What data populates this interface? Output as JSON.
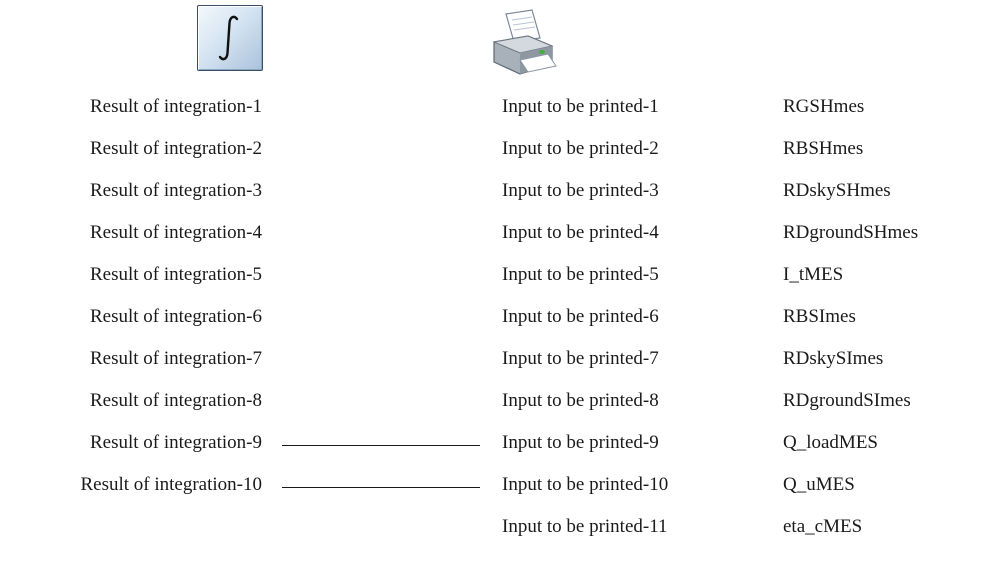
{
  "integrator": {
    "icon": "integral-icon"
  },
  "printer": {
    "icon": "printer-icon"
  },
  "integration_outputs": [
    "Result of integration-1",
    "Result of integration-2",
    "Result of integration-3",
    "Result of integration-4",
    "Result of integration-5",
    "Result of integration-6",
    "Result of integration-7",
    "Result of integration-8",
    "Result of integration-9",
    "Result of integration-10"
  ],
  "printer_inputs": [
    "Input to be printed-1",
    "Input to be printed-2",
    "Input to be printed-3",
    "Input to be printed-4",
    "Input to be printed-5",
    "Input to be printed-6",
    "Input to be printed-7",
    "Input to be printed-8",
    "Input to be printed-9",
    "Input to be printed-10",
    "Input to be printed-11"
  ],
  "variable_names": [
    "RGSHmes",
    "RBSHmes",
    "RDskySHmes",
    "RDgroundSHmes",
    "I_tMES",
    "RBSImes",
    "RDskySImes",
    "RDgroundSImes",
    "Q_loadMES",
    "Q_uMES",
    "eta_cMES"
  ],
  "connections": [
    {
      "from": "Result of integration-9",
      "to": "Input to be printed-9"
    },
    {
      "from": "Result of integration-10",
      "to": "Input to be printed-10"
    }
  ]
}
